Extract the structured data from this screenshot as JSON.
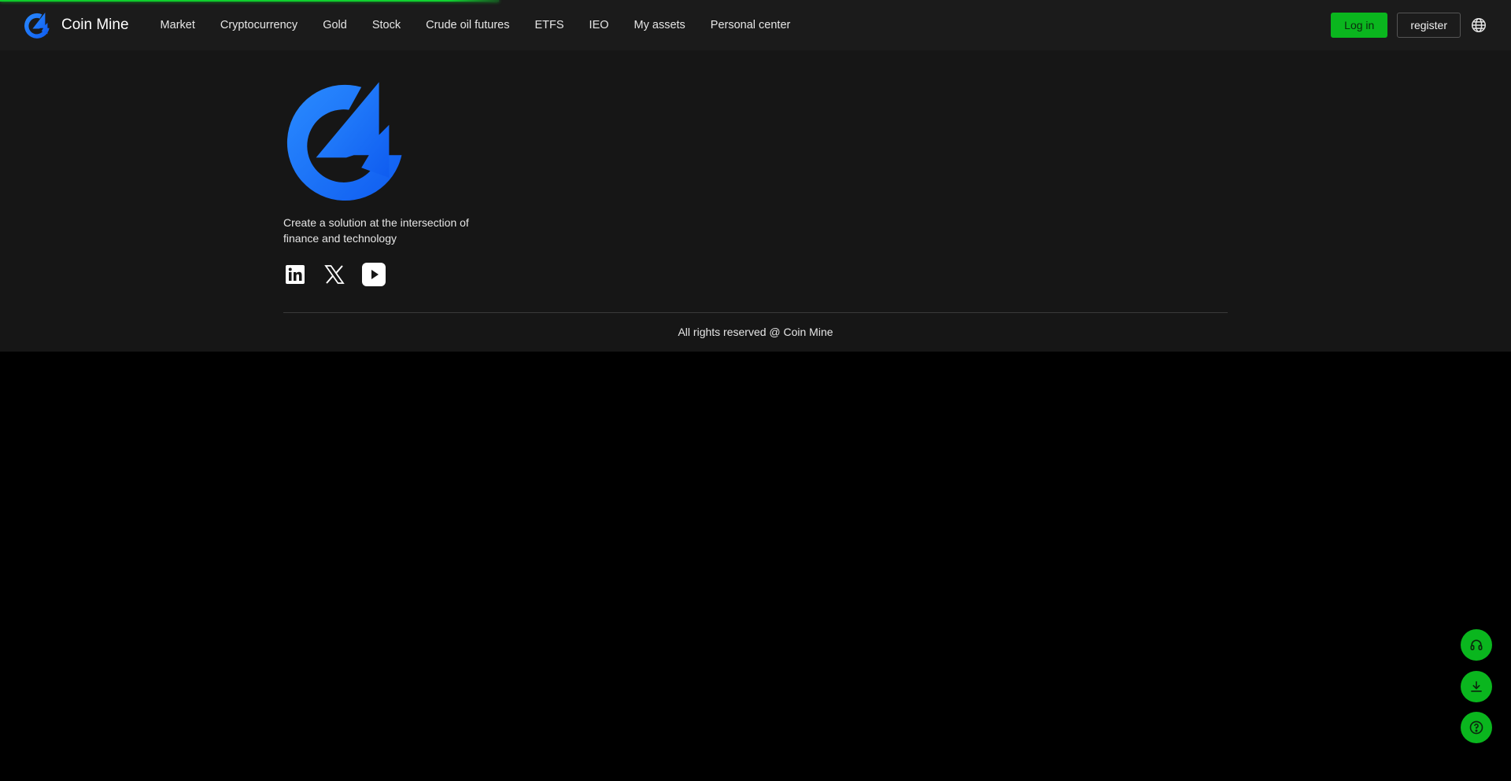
{
  "brand": {
    "name": "Coin Mine",
    "logo_color": "#1a73ff"
  },
  "nav": {
    "items": [
      {
        "label": "Market"
      },
      {
        "label": "Cryptocurrency"
      },
      {
        "label": "Gold"
      },
      {
        "label": "Stock"
      },
      {
        "label": "Crude oil futures"
      },
      {
        "label": "ETFS"
      },
      {
        "label": "IEO"
      },
      {
        "label": "My assets"
      },
      {
        "label": "Personal center"
      }
    ],
    "login_label": "Log in",
    "register_label": "register",
    "language_icon": "globe-icon"
  },
  "page_load_progress": 0.33,
  "footer": {
    "tagline": "Create a solution at the intersection of finance and technology",
    "socials": [
      {
        "icon": "linkedin-icon"
      },
      {
        "icon": "x-twitter-icon"
      },
      {
        "icon": "youtube-icon"
      }
    ],
    "copyright": "All rights reserved @ Coin Mine"
  },
  "floating_actions": [
    {
      "icon": "headset-icon"
    },
    {
      "icon": "download-icon"
    },
    {
      "icon": "help-icon"
    }
  ],
  "colors": {
    "accent_green": "#0ab61e",
    "nav_bg": "#1b1b1b",
    "footer_bg": "#161616",
    "page_bg": "#000000",
    "brand_blue": "#1a73ff"
  }
}
